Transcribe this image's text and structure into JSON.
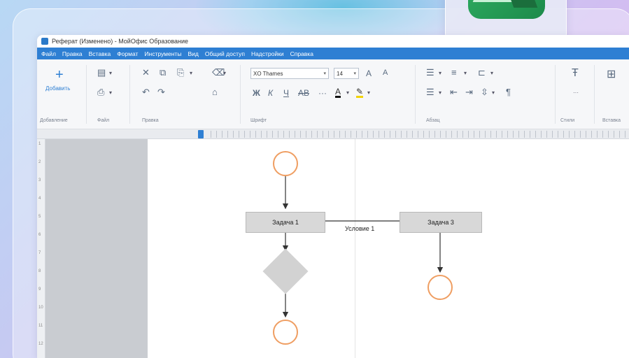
{
  "window": {
    "title": "Реферат (Изменено) - МойОфис Образование"
  },
  "menu": [
    "Файл",
    "Правка",
    "Вставка",
    "Формат",
    "Инструменты",
    "Вид",
    "Общий доступ",
    "Надстройки",
    "Справка"
  ],
  "ribbon": {
    "add_label": "Добавить",
    "font_name": "XO Thames",
    "font_size": "14",
    "groups": {
      "insert": "Добавление",
      "file": "Файл",
      "edit": "Правка",
      "font": "Шрифт",
      "paragraph": "Абзац",
      "styles": "Стили",
      "insert2": "Вставка"
    },
    "buttons": {
      "bold": "Ж",
      "italic": "К",
      "underline": "Ч",
      "strike": "AB",
      "more": "···",
      "grow_font": "A",
      "shrink_font": "A"
    }
  },
  "flowchart": {
    "task1": "Задача 1",
    "task3": "Задача 3",
    "condition": "Условие 1"
  },
  "ruler": {
    "vertical_numbers": [
      "1",
      "2",
      "3",
      "4",
      "5",
      "6",
      "7",
      "8",
      "9",
      "10",
      "11",
      "12"
    ]
  },
  "colors": {
    "accent": "#2e7fd3",
    "circle_stroke": "#ef9e62",
    "task_fill": "#d8d8d8",
    "brand_green": "#2fae62"
  }
}
